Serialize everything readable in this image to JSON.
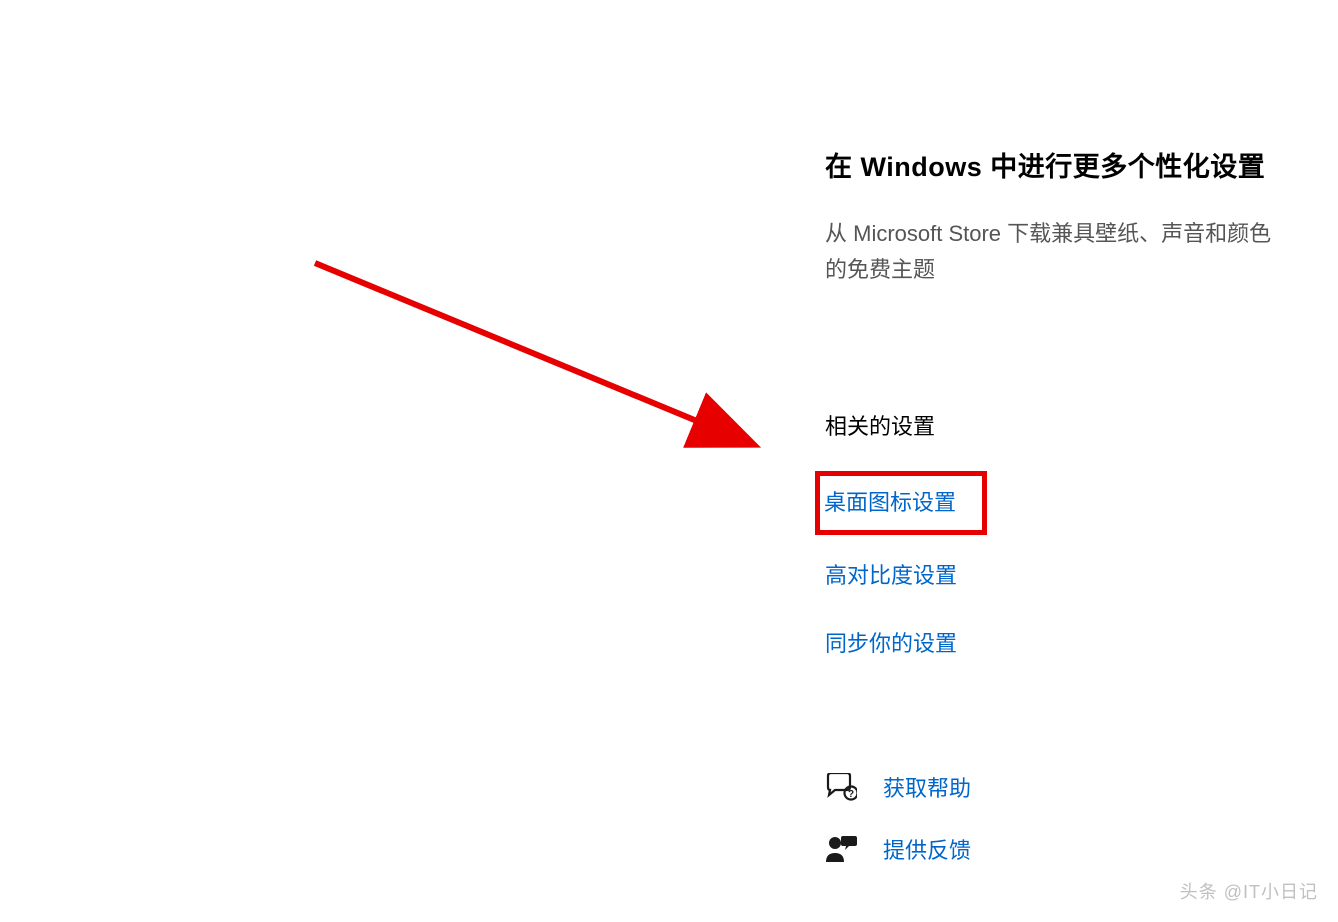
{
  "personalization": {
    "title": "在 Windows 中进行更多个性化设置",
    "description": "从 Microsoft Store 下载兼具壁纸、声音和颜色的免费主题"
  },
  "related": {
    "title": "相关的设置",
    "links": {
      "desktop_icons": "桌面图标设置",
      "high_contrast": "高对比度设置",
      "sync": "同步你的设置"
    }
  },
  "support": {
    "help": "获取帮助",
    "feedback": "提供反馈"
  },
  "watermark": "头条 @IT小日记"
}
